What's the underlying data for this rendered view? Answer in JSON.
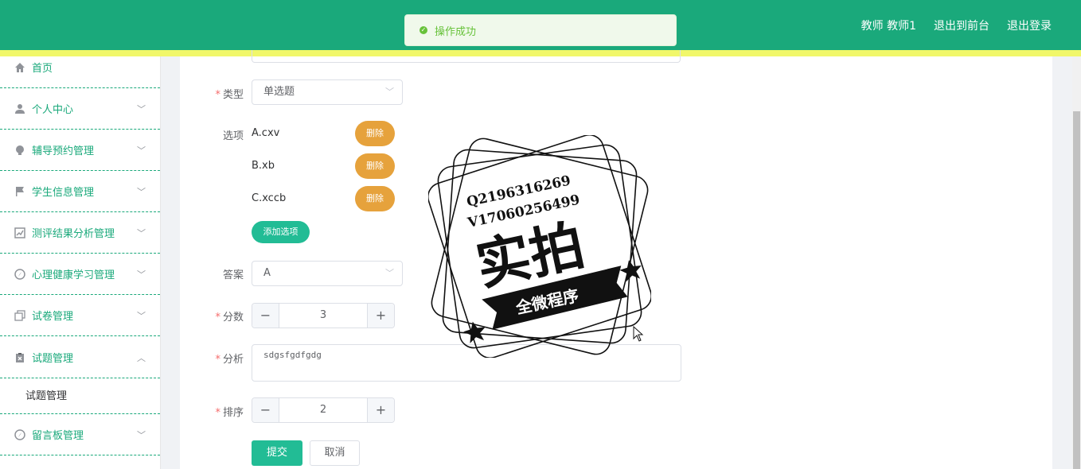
{
  "header": {
    "user_label": "教师 教师1",
    "front_link": "退出到前台",
    "logout_link": "退出登录"
  },
  "toast": {
    "message": "操作成功"
  },
  "sidebar": {
    "items": [
      {
        "label": "首页",
        "icon": "home-icon"
      },
      {
        "label": "个人中心",
        "icon": "user-icon"
      },
      {
        "label": "辅导预约管理",
        "icon": "bulb-icon"
      },
      {
        "label": "学生信息管理",
        "icon": "flag-icon"
      },
      {
        "label": "测评结果分析管理",
        "icon": "chart-icon"
      },
      {
        "label": "心理健康学习管理",
        "icon": "compass-icon"
      },
      {
        "label": "试卷管理",
        "icon": "copy-icon"
      },
      {
        "label": "试题管理",
        "icon": "clipboard-icon"
      },
      {
        "label": "留言板管理",
        "icon": "compass-icon"
      }
    ],
    "sub_item": "试题管理"
  },
  "form": {
    "type_label": "类型",
    "type_value": "单选题",
    "options_label": "选项",
    "options": [
      "A.cxv",
      "B.xb",
      "C.xccb"
    ],
    "delete_label": "删除",
    "add_option_label": "添加选项",
    "answer_label": "答案",
    "answer_value": "A",
    "score_label": "分数",
    "score_value": "3",
    "analysis_label": "分析",
    "analysis_value": "sdgsfgdfgdg",
    "order_label": "排序",
    "order_value": "2",
    "submit_label": "提交",
    "cancel_label": "取消"
  },
  "watermark": {
    "line1": "Q2196316269",
    "line2": "V17060256499",
    "main": "实拍",
    "ribbon": "全微程序"
  },
  "colors": {
    "header": "#1aa97b",
    "strip": "#f1f76a",
    "delete": "#e6a23c",
    "primary": "#22bc95"
  }
}
